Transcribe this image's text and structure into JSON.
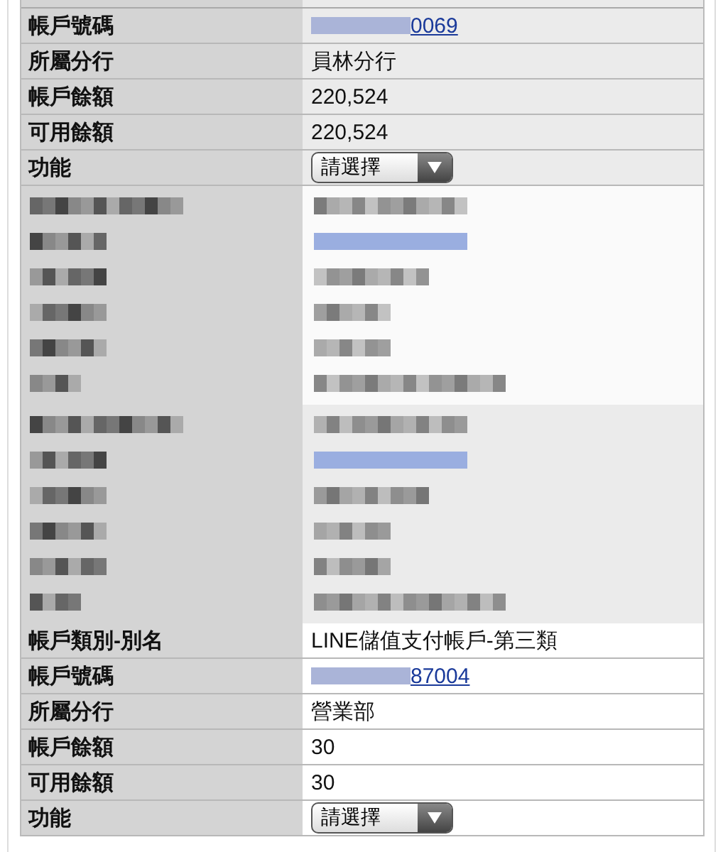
{
  "sections": [
    {
      "kind": "account",
      "highlighted": true,
      "rows": [
        {
          "kind": "link",
          "label": "帳戶號碼",
          "value": "0069"
        },
        {
          "kind": "text",
          "label": "所屬分行",
          "value": "員林分行"
        },
        {
          "kind": "text",
          "label": "帳戶餘額",
          "value": "220,524"
        },
        {
          "kind": "text",
          "label": "可用餘額",
          "value": "220,524"
        },
        {
          "kind": "select",
          "label": "功能",
          "value": "請選擇"
        }
      ]
    },
    {
      "kind": "redacted",
      "highlighted": false
    },
    {
      "kind": "redacted",
      "highlighted": true
    },
    {
      "kind": "account",
      "highlighted": false,
      "rows": [
        {
          "kind": "text",
          "label": "帳戶類別-別名",
          "value": "LINE儲值支付帳戶-第三類"
        },
        {
          "kind": "link",
          "label": "帳戶號碼",
          "value": "87004"
        },
        {
          "kind": "text",
          "label": "所屬分行",
          "value": "營業部"
        },
        {
          "kind": "text",
          "label": "帳戶餘額",
          "value": "30"
        },
        {
          "kind": "text",
          "label": "可用餘額",
          "value": "30"
        },
        {
          "kind": "select",
          "label": "功能",
          "value": "請選擇"
        }
      ]
    }
  ]
}
